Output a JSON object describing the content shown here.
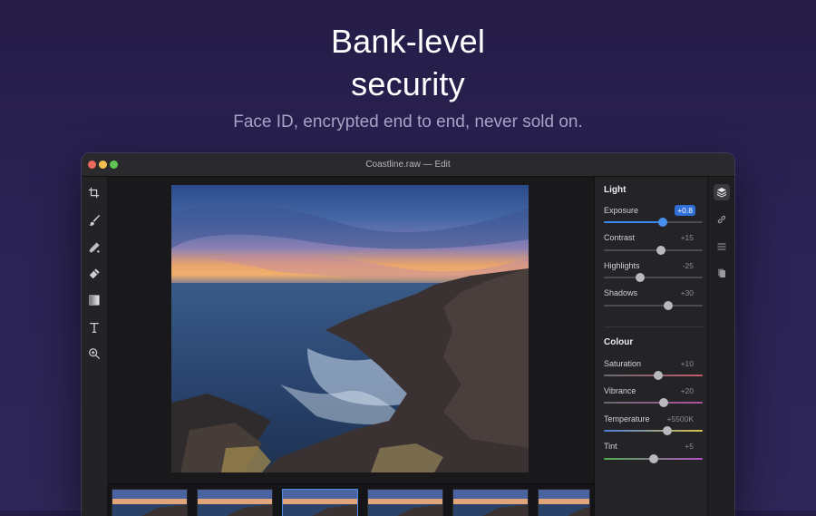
{
  "hero": {
    "title_line1": "Bank-level",
    "title_line2": "security",
    "subtitle": "Face ID, encrypted end to end, never sold on."
  },
  "window": {
    "title": "Coastline.raw — Edit"
  },
  "tools": [
    {
      "icon": "crop-icon"
    },
    {
      "icon": "brush-icon"
    },
    {
      "icon": "healing-icon"
    },
    {
      "icon": "clone-stamp-icon"
    },
    {
      "icon": "gradient-icon"
    },
    {
      "icon": "text-icon"
    },
    {
      "icon": "zoom-icon"
    }
  ],
  "panel": {
    "light": {
      "title": "Light",
      "rows": [
        {
          "label": "Exposure",
          "value": "+0.8",
          "level": 0.6
        },
        {
          "label": "Contrast",
          "value": "+15",
          "level": 0.58
        },
        {
          "label": "Highlights",
          "value": "-25",
          "level": 0.37
        },
        {
          "label": "Shadows",
          "value": "+30",
          "level": 0.65
        }
      ]
    },
    "colour": {
      "title": "Colour",
      "rows": [
        {
          "label": "Saturation",
          "value": "+10",
          "level": 0.55
        },
        {
          "label": "Vibrance",
          "value": "+20",
          "level": 0.61
        },
        {
          "label": "Temperature",
          "value": "+5500K",
          "level": 0.64
        },
        {
          "label": "Tint",
          "value": "+5",
          "level": 0.5
        }
      ]
    }
  },
  "rail": [
    {
      "icon": "layers-icon",
      "active": true
    },
    {
      "icon": "link-icon",
      "active": false
    },
    {
      "icon": "list-icon",
      "active": false
    },
    {
      "icon": "copy-settings-icon",
      "active": false
    }
  ],
  "filmstrip": {
    "count": 6,
    "selected_index": 2
  },
  "colors": {
    "accent": "#3d86f0",
    "background": "#251c48",
    "window": "#1c1c1f"
  }
}
